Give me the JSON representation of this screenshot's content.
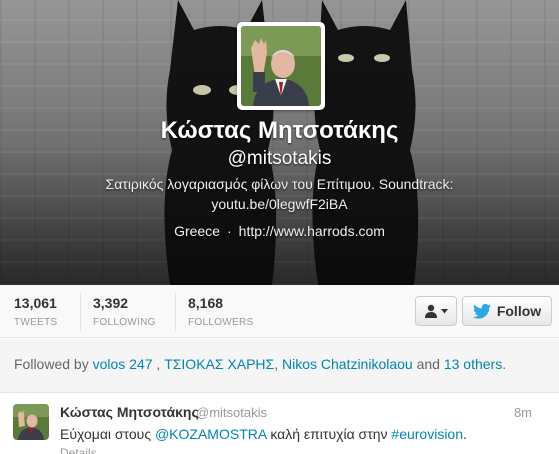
{
  "profile": {
    "name": "Κώστας Μητσοτάκης",
    "handle": "@mitsotakis",
    "bio_line1": "Σατιρικός λογαριασμός φίλων του Επίτιμου. Soundtrack:",
    "bio_line2": "youtu.be/0legwfF2iBA",
    "location": "Greece",
    "separator": "·",
    "website": "http://www.harrods.com"
  },
  "stats": [
    {
      "value": "13,061",
      "label": "TWEETS"
    },
    {
      "value": "3,392",
      "label": "FOLLOWING"
    },
    {
      "value": "8,168",
      "label": "FOLLOWERS"
    }
  ],
  "actions": {
    "user_menu_icon": "user-icon",
    "follow_label": "Follow",
    "follow_icon": "twitter-bird-icon"
  },
  "followed_by": {
    "prefix": "Followed by",
    "user1": "volos 247",
    "sep1": " ,",
    "user2": "ΤΣΙΟΚΑΣ ΧΑΡΗΣ",
    "sep2": ",",
    "user3": "Nikos Chatzinikolaou",
    "and_text": "and",
    "others": "13 others",
    "suffix": "."
  },
  "tweet": {
    "name": "Κώστας Μητσοτάκης",
    "handle": "@mitsotakis",
    "time": "8m",
    "text_part1": "Εύχομαι στους",
    "mention": "@KOZAMOSTRA",
    "text_part2": "καλή επιτυχία στην",
    "hashtag": "#eurovision",
    "text_part3": ".",
    "details": "Details"
  },
  "colors": {
    "link": "#0084b4",
    "twitter_blue": "#2aa9e0"
  }
}
